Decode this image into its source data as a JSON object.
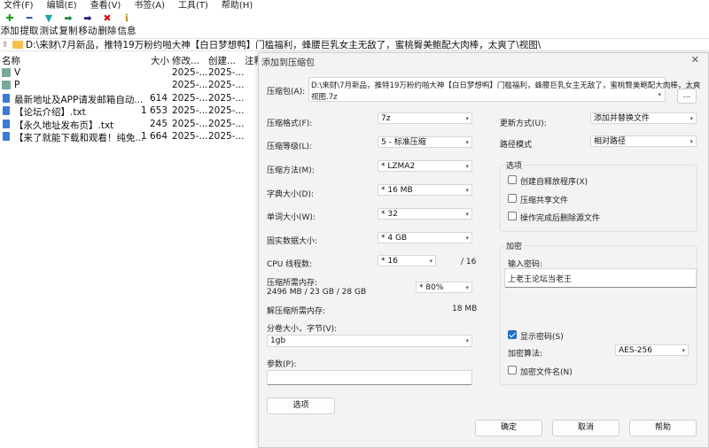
{
  "menu": [
    "文件(F)",
    "编辑(E)",
    "查看(V)",
    "书签(A)",
    "工具(T)",
    "帮助(H)"
  ],
  "toolbar": [
    {
      "label": "添加",
      "icon": "plus-icon",
      "glyph": "✚",
      "color": "#1aa31a"
    },
    {
      "label": "提取",
      "icon": "minus-icon",
      "glyph": "━",
      "color": "#2540a8"
    },
    {
      "label": "测试",
      "icon": "test-icon",
      "glyph": "▼",
      "color": "#1aa3a0"
    },
    {
      "label": "复制",
      "icon": "copy-arrow-icon",
      "glyph": "➡",
      "color": "#1a8a3a"
    },
    {
      "label": "移动",
      "icon": "move-arrow-icon",
      "glyph": "➡",
      "color": "#23207a"
    },
    {
      "label": "删除",
      "icon": "delete-icon",
      "glyph": "✖",
      "color": "#d01818"
    },
    {
      "label": "信息",
      "icon": "info-icon",
      "glyph": "ℹ",
      "color": "#b88a00"
    }
  ],
  "path": "D:\\来财\\7月新品，推特19万粉约啪大神【白日梦想鸭】门槛福利，蜂腰巨乳女主无敌了，蜜桃臀美鲍配大肉棒，太爽了\\视图\\",
  "columns": {
    "name": "名称",
    "size": "大小",
    "modified": "修改...",
    "created": "创建...",
    "comment": "注释"
  },
  "files": [
    {
      "name": "V",
      "type": "folder",
      "size": "",
      "modified": "2025-...",
      "created": "2025-..."
    },
    {
      "name": "P",
      "type": "folder",
      "size": "",
      "modified": "2025-...",
      "created": "2025-..."
    },
    {
      "name": "最新地址及APP请发邮箱自动...",
      "type": "file",
      "size": "614",
      "modified": "2025-...",
      "created": "2025-..."
    },
    {
      "name": "【论坛介绍】.txt",
      "type": "file",
      "size": "1 653",
      "modified": "2025-...",
      "created": "2025-..."
    },
    {
      "name": "【永久地址发布页】.txt",
      "type": "file",
      "size": "245",
      "modified": "2025-...",
      "created": "2025-..."
    },
    {
      "name": "【来了就能下载和观看！纯免...",
      "type": "file",
      "size": "1 664",
      "modified": "2025-...",
      "created": "2025-..."
    }
  ],
  "dialog": {
    "title": "添加到压缩包",
    "close": "✕",
    "archive_label": "压缩包(A):",
    "archive_path_line1": "D:\\来财\\7月新品，推特19万粉约啪大神【白日梦想鸭】门槛福利，蜂腰巨乳女主无敌了，蜜桃臀美鲍配大肉棒，太爽",
    "archive_path_line2": "视图.7z",
    "browse": "...",
    "format_label": "压缩格式(F):",
    "format_value": "7z",
    "level_label": "压缩等级(L):",
    "level_value": "5 - 标准压缩",
    "method_label": "压缩方法(M):",
    "method_value": "*  LZMA2",
    "dict_label": "字典大小(D):",
    "dict_value": "*  16 MB",
    "word_label": "单词大小(W):",
    "word_value": "*  32",
    "solid_label": "固实数据大小:",
    "solid_value": "*  4 GB",
    "cpu_label": "CPU 线程数:",
    "cpu_value": "*  16",
    "cpu_total": "/ 16",
    "mem_label": "压缩所需内存:",
    "mem_value": "2496 MB / 23 GB / 28 GB",
    "mem_percent": "* 80%",
    "decomp_label": "解压缩所需内存:",
    "decomp_value": "18 MB",
    "split_label": "分卷大小，字节(V):",
    "split_value": "1gb",
    "params_label": "参数(P):",
    "params_value": "",
    "options_button": "选项",
    "update_label": "更新方式(U):",
    "update_value": "添加并替换文件",
    "pathmode_label": "路径模式",
    "pathmode_value": "相对路径",
    "options_group": "选项",
    "opt_sfx": "创建自释放程序(X)",
    "opt_shared": "压缩共享文件",
    "opt_delete": "操作完成后删除源文件",
    "encrypt_group": "加密",
    "password_label": "输入密码:",
    "password_value": "上老王论坛当老王",
    "show_password": "显示密码(S)",
    "enc_method_label": "加密算法:",
    "enc_method_value": "AES-256",
    "enc_names": "加密文件名(N)",
    "ok": "确定",
    "cancel": "取消",
    "help": "帮助"
  }
}
